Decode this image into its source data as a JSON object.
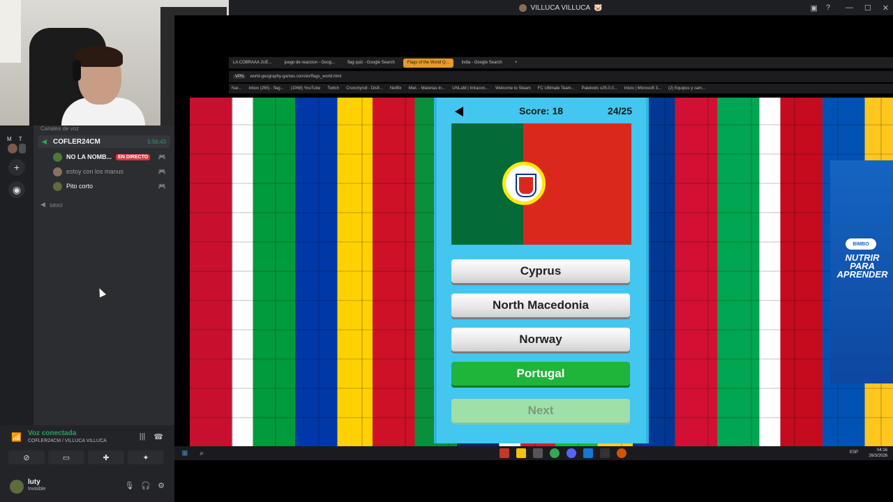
{
  "window": {
    "title": "VILLUCA VILLUCA",
    "title_emoji": "🐷"
  },
  "discord": {
    "servers": {
      "letters": "M T"
    },
    "category_label": "Canales de voz",
    "voice_channel": {
      "name": "COFLER24CM",
      "time": "5:56:43"
    },
    "members": [
      {
        "name": "NO LA NOMB...",
        "badge": "EN DIRECTO",
        "color": "#f2f3f5",
        "bold": true
      },
      {
        "name": "estoy con los manus",
        "color": "#949ba4",
        "bold": false
      },
      {
        "name": "Pito corto",
        "color": "#f2f3f5",
        "bold": false
      }
    ],
    "other_channel": "sexo",
    "voice_status": "Voz conectada",
    "voice_sub": "COFLER24CM / VILLUCA VILLUCA",
    "user": {
      "name": "luty",
      "status": "Invisible"
    }
  },
  "browser": {
    "tabs": [
      {
        "label": "LA COBRAAA JUE...",
        "active": false
      },
      {
        "label": "juego de reaccion - Goog...",
        "active": false
      },
      {
        "label": "flag quiz - Google Search",
        "active": false
      },
      {
        "label": "Flags of the World Q...",
        "active": true
      },
      {
        "label": "india - Google Search",
        "active": false
      }
    ],
    "url": "world-geography-games.com/en/flags_world.html",
    "vpn_label": "VPN",
    "bookmarks": [
      "Nar...",
      "Inbox (265) - flag...",
      "(1068) YouTube",
      "Twitch",
      "Crunchyroll - Disfr...",
      "Netflix",
      "Miel. - Materias In...",
      "UNLaM | Intracon...",
      "Welcome to Steam",
      "FC Ultimate Team...",
      "Paletools v25.0.0...",
      "Inicio | Microsoft 3...",
      "(2) Equipos y cam..."
    ]
  },
  "quiz": {
    "score_label": "Score: 18",
    "progress": "24/25",
    "options": [
      {
        "label": "Cyprus",
        "correct": false
      },
      {
        "label": "North Macedonia",
        "correct": false
      },
      {
        "label": "Norway",
        "correct": false
      },
      {
        "label": "Portugal",
        "correct": true
      }
    ],
    "next_label": "Next"
  },
  "ad": {
    "brand": "BIMBO",
    "text": "NUTRIR PARA APRENDER"
  },
  "taskbar": {
    "lang": "ESP",
    "time": "04:16",
    "date": "26/3/2026"
  }
}
